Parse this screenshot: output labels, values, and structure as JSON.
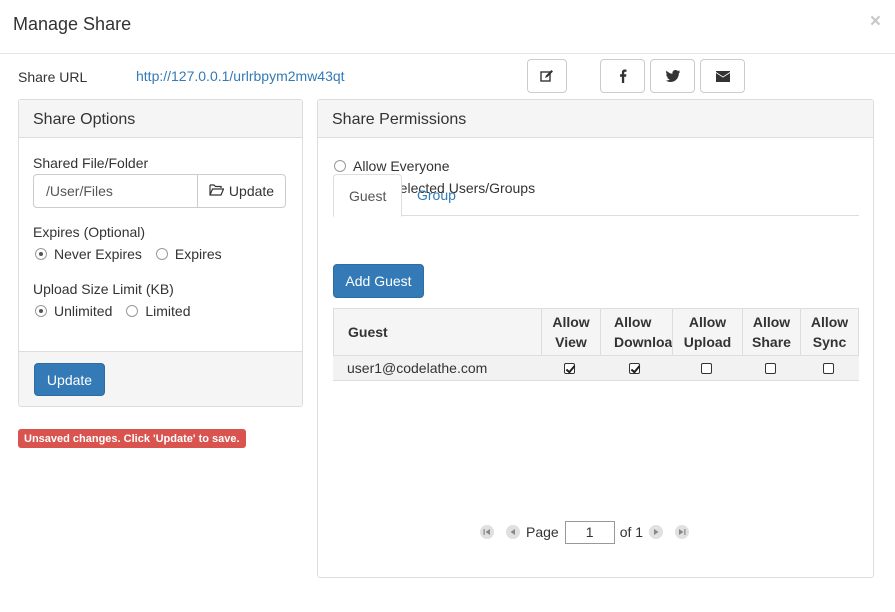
{
  "modal": {
    "title": "Manage Share",
    "close_glyph": "×"
  },
  "share_url": {
    "label": "Share URL",
    "link": "http://127.0.0.1/urlrbpym2mw43qt"
  },
  "toolbar": {
    "icons": [
      "edit-icon",
      "facebook-icon",
      "twitter-icon",
      "email-icon"
    ]
  },
  "share_options": {
    "heading": "Share Options",
    "file_label": "Shared File/Folder",
    "path_value": "/User/Files",
    "update_addon_label": "Update",
    "expires_label": "Expires (Optional)",
    "never_expires_label": "Never Expires",
    "expires_label_opt": "Expires",
    "expires_selected": "Never Expires",
    "upload_limit_label": "Upload Size Limit (KB)",
    "unlimited_label": "Unlimited",
    "limited_label": "Limited",
    "upload_selected": "Unlimited",
    "update_button": "Update"
  },
  "unsaved_notice": "Unsaved changes. Click 'Update' to save.",
  "share_permissions": {
    "heading": "Share Permissions",
    "allow_everyone_label": "Allow Everyone",
    "allow_selected_label": "Allow Selected Users/Groups",
    "selected_option": "Allow Selected Users/Groups",
    "tabs": [
      {
        "label": "Guest",
        "active": true
      },
      {
        "label": "Group",
        "active": false
      }
    ],
    "add_guest_button": "Add Guest",
    "table": {
      "headers": [
        {
          "line1": "Guest",
          "line2": ""
        },
        {
          "line1": "Allow",
          "line2": "View"
        },
        {
          "line1": "Allow",
          "line2": "Download"
        },
        {
          "line1": "Allow",
          "line2": "Upload"
        },
        {
          "line1": "Allow",
          "line2": "Share"
        },
        {
          "line1": "Allow",
          "line2": "Sync"
        }
      ],
      "rows": [
        {
          "guest": "user1@codelathe.com",
          "view": true,
          "download": true,
          "upload": false,
          "share": false,
          "sync": false
        }
      ]
    },
    "pager": {
      "page_label": "Page",
      "page_value": "1",
      "of_label": "of 1"
    }
  },
  "colors": {
    "primary": "#337ab7",
    "danger": "#d9534f",
    "panel_heading_bg": "#f5f5f5"
  }
}
